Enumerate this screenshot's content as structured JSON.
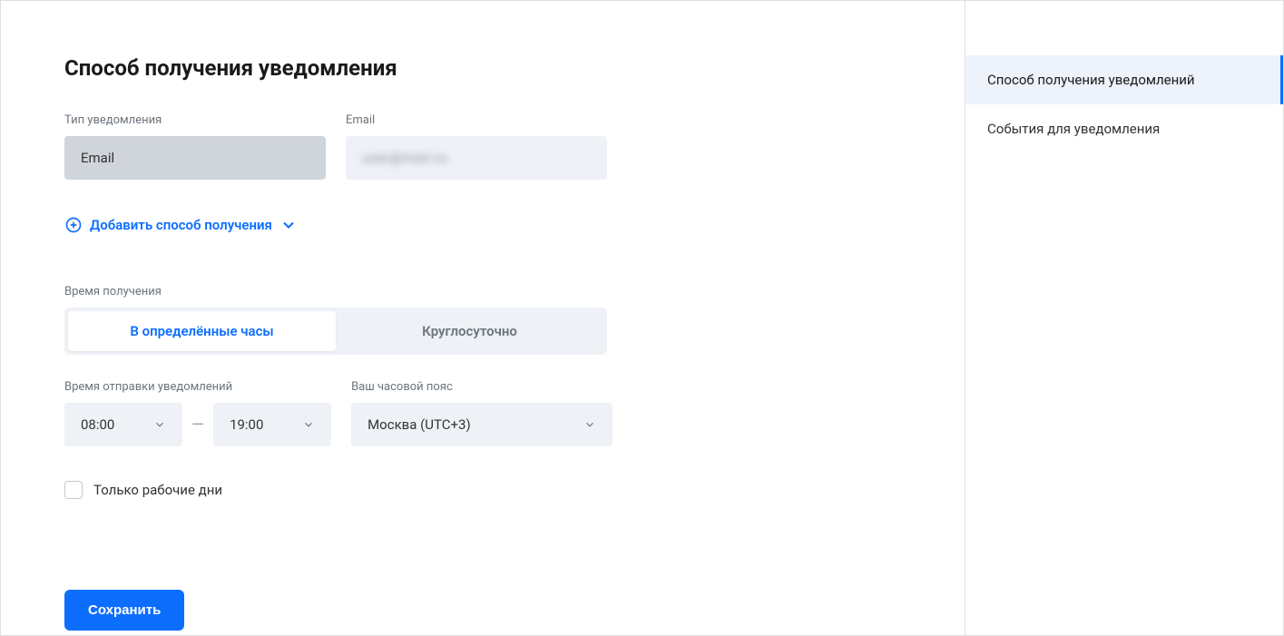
{
  "page": {
    "title": "Способ получения уведомления"
  },
  "fields": {
    "type_label": "Тип уведомления",
    "type_value": "Email",
    "email_label": "Email",
    "email_value": "user@mail.ru"
  },
  "add_method_label": "Добавить способ получения",
  "receive_time_label": "Время получения",
  "segmented": {
    "specific_hours": "В определённые часы",
    "all_day": "Круглосуточно"
  },
  "send_time_label": "Время отправки уведомлений",
  "time_from": "08:00",
  "time_to": "19:00",
  "tz_label": "Ваш часовой пояс",
  "tz_value": "Москва (UTC+3)",
  "workdays_only_label": "Только рабочие дни",
  "save_label": "Сохранить",
  "sidebar": {
    "method": "Способ получения уведомлений",
    "events": "События для уведомления"
  }
}
